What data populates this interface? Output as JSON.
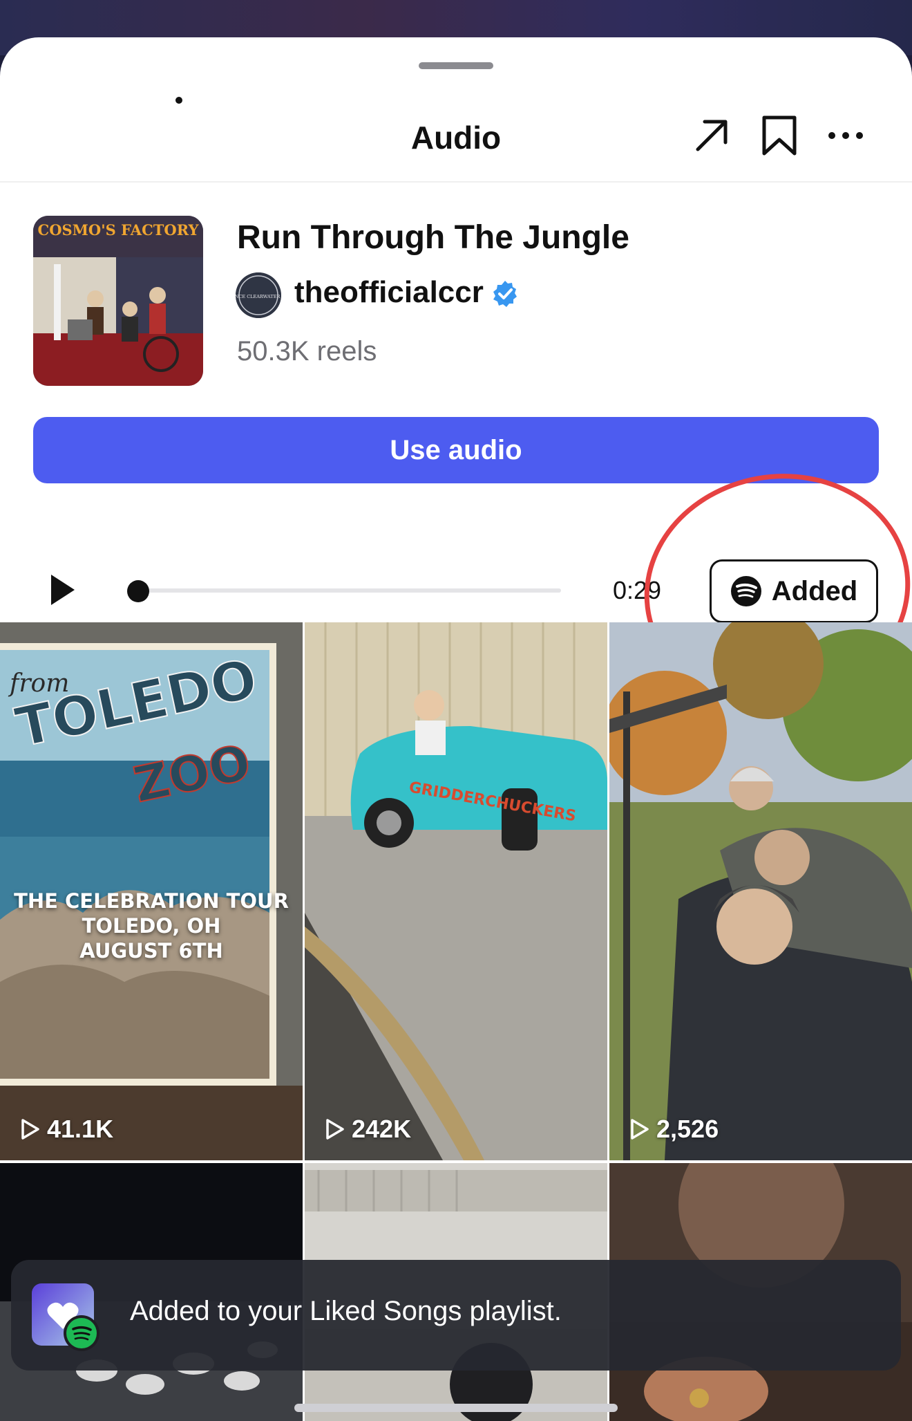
{
  "header": {
    "title": "Audio",
    "share_icon": "arrow-up-right-icon",
    "save_icon": "bookmark-icon",
    "more_icon": "more-horizontal-icon"
  },
  "track": {
    "title": "Run Through The Jungle",
    "artist": "theofficialccr",
    "reels_count": "50.3K reels",
    "cover_text": "COSMO'S FACTORY",
    "avatar_text": "CREEDENCE CLEARWATER REVIVAL",
    "verified": true
  },
  "actions": {
    "use_audio_label": "Use audio",
    "added_label": "Added",
    "added_icon": "spotify-icon"
  },
  "player": {
    "time": "0:29",
    "progress": 0.0
  },
  "reels": [
    {
      "views": "41.1K",
      "overlay": [
        "THE CELEBRATION TOUR",
        "TOLEDO, OH",
        "AUGUST 6TH"
      ],
      "postcard": [
        "from",
        "TOLEDO",
        "ZOO"
      ]
    },
    {
      "views": "242K",
      "decal": "GRIDDERCHUCKERS"
    },
    {
      "views": "2,526"
    },
    {},
    {},
    {}
  ],
  "toast": {
    "message": "Added to your Liked Songs playlist."
  },
  "colors": {
    "accent": "#4d5cf0",
    "highlight": "#e64242",
    "verified": "#3897f0",
    "spotify": "#1db954"
  }
}
